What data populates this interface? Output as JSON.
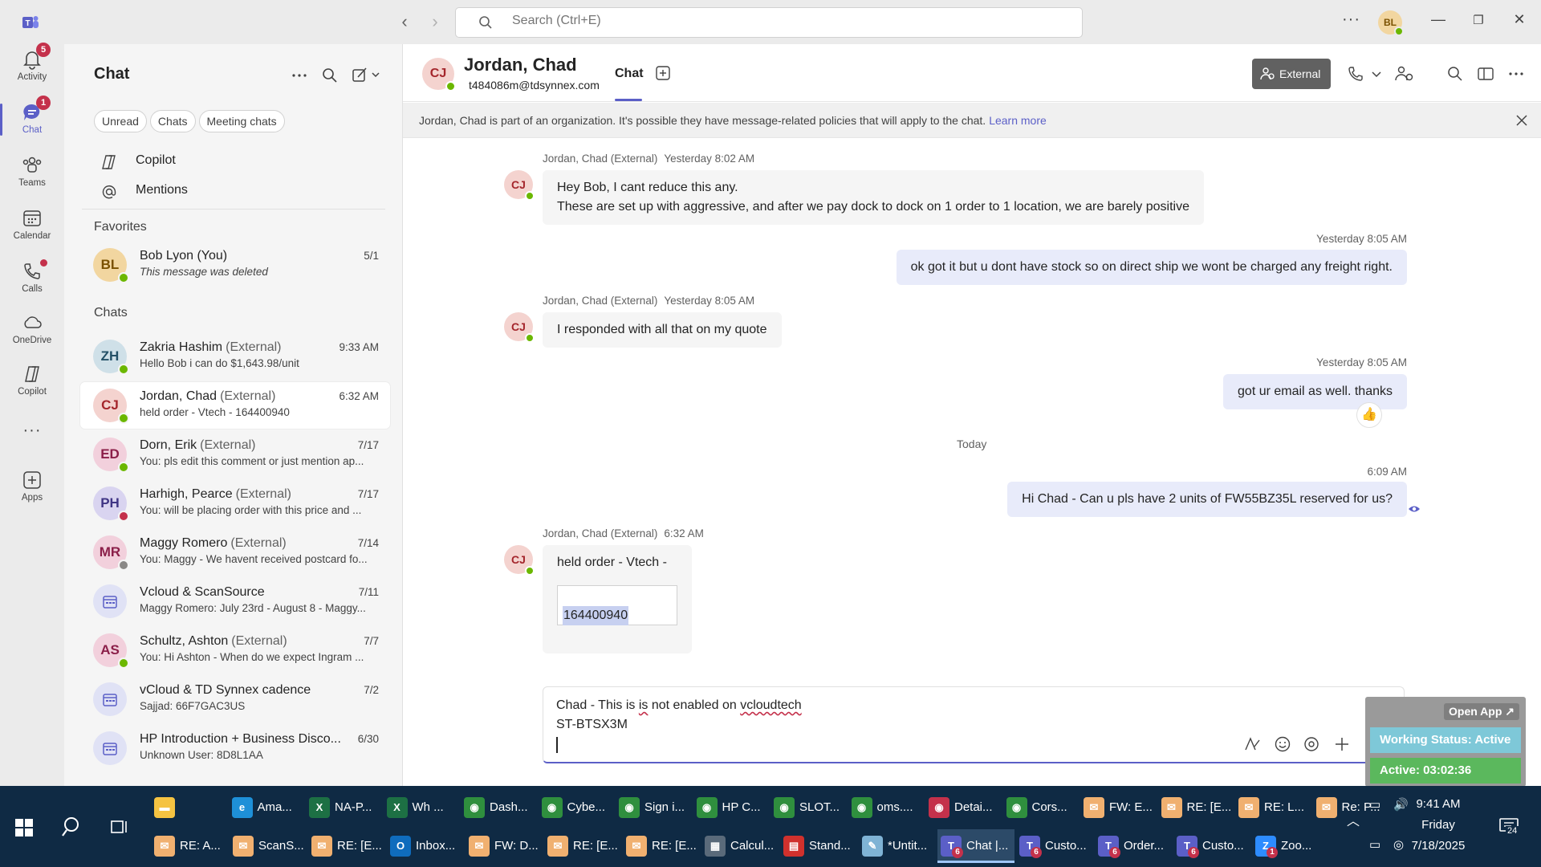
{
  "titlebar": {
    "search_placeholder": "Search (Ctrl+E)",
    "avatar_initials": "BL",
    "more": "···"
  },
  "rail": [
    {
      "label": "Activity",
      "badge": "5"
    },
    {
      "label": "Chat",
      "badge": "1"
    },
    {
      "label": "Teams"
    },
    {
      "label": "Calendar"
    },
    {
      "label": "Calls"
    },
    {
      "label": "OneDrive"
    },
    {
      "label": "Copilot"
    },
    {
      "label": "Apps"
    }
  ],
  "list": {
    "title": "Chat",
    "filters": [
      "Unread",
      "Chats",
      "Meeting chats"
    ],
    "links": [
      "Copilot",
      "Mentions"
    ],
    "favorites_label": "Favorites",
    "chats_label": "Chats",
    "favorites": [
      {
        "initials": "BL",
        "name": "Bob Lyon (You)",
        "ext": "",
        "preview": "This message was deleted",
        "time": "5/1",
        "avbg": "#f2d6a0",
        "avfg": "#7a5100",
        "status": "#6bb700"
      }
    ],
    "chats": [
      {
        "initials": "ZH",
        "name": "Zakria Hashim",
        "ext": "(External)",
        "preview": "Hello Bob i can do $1,643.98/unit",
        "time": "9:33 AM",
        "avbg": "#cfe0e8",
        "avfg": "#235066",
        "status": "#6bb700"
      },
      {
        "initials": "CJ",
        "name": "Jordan, Chad",
        "ext": "(External)",
        "preview": "held order - Vtech -    164400940",
        "time": "6:32 AM",
        "avbg": "#f4d3cf",
        "avfg": "#a4262c",
        "status": "#6bb700"
      },
      {
        "initials": "ED",
        "name": "Dorn, Erik",
        "ext": "(External)",
        "preview": "You: pls edit this comment or just mention ap...",
        "time": "7/17",
        "avbg": "#f2d0dc",
        "avfg": "#8b1f49",
        "status": "#6bb700"
      },
      {
        "initials": "PH",
        "name": "Harhigh, Pearce",
        "ext": "(External)",
        "preview": "You: will be placing order with this price and ...",
        "time": "7/17",
        "avbg": "#d9d4f0",
        "avfg": "#3f3484",
        "status": "#c4314b"
      },
      {
        "initials": "MR",
        "name": "Maggy Romero",
        "ext": "(External)",
        "preview": "You: Maggy - We havent received postcard fo...",
        "time": "7/14",
        "avbg": "#f2d0dc",
        "avfg": "#8b1f49",
        "status": "#8a8886"
      },
      {
        "initials": "",
        "name": "Vcloud & ScanSource",
        "ext": "",
        "preview": "Maggy Romero: July 23rd - August 8 - Maggy...",
        "time": "7/11",
        "avbg": "#e0e2f5",
        "avfg": "#5b5fc7",
        "status": ""
      },
      {
        "initials": "AS",
        "name": "Schultz, Ashton",
        "ext": "(External)",
        "preview": "You: Hi Ashton -  When do we expect Ingram ...",
        "time": "7/7",
        "avbg": "#f2d0dc",
        "avfg": "#8b1f49",
        "status": "#6bb700"
      },
      {
        "initials": "",
        "name": "vCloud & TD Synnex cadence",
        "ext": "",
        "preview": "Sajjad: 66F7GAC3US",
        "time": "7/2",
        "avbg": "#e0e2f5",
        "avfg": "#5b5fc7",
        "status": ""
      },
      {
        "initials": "",
        "name": "HP Introduction + Business Disco...",
        "ext": "",
        "preview": "Unknown User: 8D8L1AA",
        "time": "6/30",
        "avbg": "#e0e2f5",
        "avfg": "#5b5fc7",
        "status": ""
      }
    ]
  },
  "header": {
    "initials": "CJ",
    "name": "Jordan, Chad",
    "email": "t484086m@tdsynnex.com",
    "tab": "Chat",
    "external_label": "External"
  },
  "banner": {
    "text": "Jordan, Chad is part of an organization. It's possible they have message-related policies that will apply to the chat.",
    "link": "Learn more"
  },
  "messages": {
    "m1_sender": "Jordan, Chad (External)",
    "m1_time": "Yesterday 8:02 AM",
    "m1_line1": "Hey Bob, I cant reduce this any.",
    "m1_line2": "These are set up with aggressive, and after we pay dock to dock on 1 order to 1 location, we are barely positive",
    "m2_time": "Yesterday 8:05 AM",
    "m2_text": "ok got it but u dont have stock so on direct ship we wont be charged any freight right.",
    "m3_sender": "Jordan, Chad (External)",
    "m3_time": "Yesterday 8:05 AM",
    "m3_text": "I responded with all that on my quote",
    "m4_time": "Yesterday 8:05 AM",
    "m4_text": "got ur email as well. thanks",
    "m4_reaction": "👍",
    "divider": "Today",
    "m5_time": "6:09 AM",
    "m5_text": "Hi Chad -  Can u pls have 2 units of FW55BZ35L reserved for us?",
    "m6_sender": "Jordan, Chad (External)",
    "m6_time": "6:32 AM",
    "m6_text": "held order - Vtech -",
    "m6_code": "164400940"
  },
  "compose": {
    "line1_a": "Chad -  This is ",
    "line1_b": "is",
    "line1_c": " not enabled on ",
    "line1_d": "vcloudtech",
    "line2": "ST-BTSX3M"
  },
  "widget": {
    "open_app": "Open App ↗",
    "status": "Working Status: Active",
    "timer": "Active: 03:02:36"
  },
  "taskbar": {
    "row1": [
      {
        "label": "",
        "color": "#f5c342",
        "glyph": "▬"
      },
      {
        "label": "Ama...",
        "color": "#1e90d8",
        "glyph": "e"
      },
      {
        "label": "NA-P...",
        "color": "#1d7044",
        "glyph": "X"
      },
      {
        "label": "Wh ...",
        "color": "#1d7044",
        "glyph": "X"
      },
      {
        "label": "Dash...",
        "color": "#2f8f3e",
        "glyph": "◉"
      },
      {
        "label": "Cybe...",
        "color": "#2f8f3e",
        "glyph": "◉"
      },
      {
        "label": "Sign i...",
        "color": "#2f8f3e",
        "glyph": "◉"
      },
      {
        "label": "HP C...",
        "color": "#2f8f3e",
        "glyph": "◉"
      },
      {
        "label": "SLOT...",
        "color": "#2f8f3e",
        "glyph": "◉"
      },
      {
        "label": "oms....",
        "color": "#2f8f3e",
        "glyph": "◉"
      },
      {
        "label": "Detai...",
        "color": "#c4314b",
        "glyph": "◉"
      },
      {
        "label": "Cors...",
        "color": "#2f8f3e",
        "glyph": "◉"
      },
      {
        "label": "FW: E...",
        "color": "#f0b070",
        "glyph": "✉"
      },
      {
        "label": "RE: [E...",
        "color": "#f0b070",
        "glyph": "✉"
      },
      {
        "label": "RE: L...",
        "color": "#f0b070",
        "glyph": "✉"
      },
      {
        "label": "Re: P...",
        "color": "#f0b070",
        "glyph": "✉"
      }
    ],
    "row2": [
      {
        "label": "RE: A...",
        "color": "#f0b070",
        "glyph": "✉",
        "count": ""
      },
      {
        "label": "ScanS...",
        "color": "#f0b070",
        "glyph": "✉",
        "count": ""
      },
      {
        "label": "RE: [E...",
        "color": "#f0b070",
        "glyph": "✉",
        "count": ""
      },
      {
        "label": "Inbox...",
        "color": "#0f6cbd",
        "glyph": "O",
        "count": ""
      },
      {
        "label": "FW: D...",
        "color": "#f0b070",
        "glyph": "✉",
        "count": ""
      },
      {
        "label": "RE: [E...",
        "color": "#f0b070",
        "glyph": "✉",
        "count": ""
      },
      {
        "label": "RE: [E...",
        "color": "#f0b070",
        "glyph": "✉",
        "count": ""
      },
      {
        "label": "Calcul...",
        "color": "#5a6a7a",
        "glyph": "▦",
        "count": ""
      },
      {
        "label": "Stand...",
        "color": "#d0312d",
        "glyph": "▤",
        "count": ""
      },
      {
        "label": "*Untit...",
        "color": "#7fb3d5",
        "glyph": "✎",
        "count": ""
      },
      {
        "label": "Chat |...",
        "color": "#5b5fc7",
        "glyph": "T",
        "count": "6",
        "active": true
      },
      {
        "label": "Custo...",
        "color": "#5b5fc7",
        "glyph": "T",
        "count": "6"
      },
      {
        "label": "Order...",
        "color": "#5b5fc7",
        "glyph": "T",
        "count": "6"
      },
      {
        "label": "Custo...",
        "color": "#5b5fc7",
        "glyph": "T",
        "count": "6"
      },
      {
        "label": "Zoo...",
        "color": "#2d8cff",
        "glyph": "Z",
        "count": "1"
      }
    ],
    "time": "9:41 AM",
    "day": "Friday",
    "date": "7/18/2025",
    "notifications": "24"
  }
}
